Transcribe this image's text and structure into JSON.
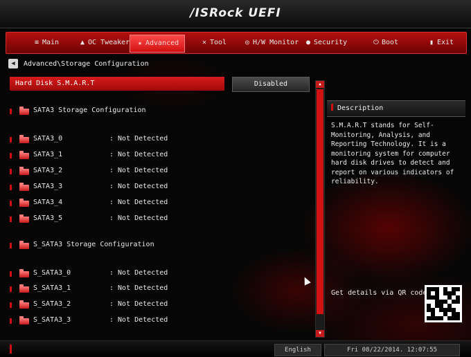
{
  "header": {
    "logo": "/ISRock UEFI"
  },
  "tabs": [
    {
      "label": "Main",
      "icon": "menu-icon",
      "glyph": "≡",
      "active": false
    },
    {
      "label": "OC Tweaker",
      "icon": "rocket-icon",
      "glyph": "▲",
      "active": false
    },
    {
      "label": "Advanced",
      "icon": "star-icon",
      "glyph": "★",
      "active": true
    },
    {
      "label": "Tool",
      "icon": "tools-icon",
      "glyph": "✕",
      "active": false
    },
    {
      "label": "H/W Monitor",
      "icon": "monitor-icon",
      "glyph": "◎",
      "active": false
    },
    {
      "label": "Security",
      "icon": "shield-icon",
      "glyph": "●",
      "active": false
    },
    {
      "label": "Boot",
      "icon": "power-icon",
      "glyph": "⏻",
      "active": false
    },
    {
      "label": "Exit",
      "icon": "exit-icon",
      "glyph": "▮",
      "active": false
    }
  ],
  "breadcrumb": "Advanced\\Storage Configuration",
  "setting": {
    "label": "Hard Disk S.M.A.R.T",
    "value": "Disabled"
  },
  "sata3": {
    "title": "SATA3 Storage Configuration",
    "ports": [
      {
        "name": "SATA3_0",
        "status": ": Not Detected"
      },
      {
        "name": "SATA3_1",
        "status": ": Not Detected"
      },
      {
        "name": "SATA3_2",
        "status": ": Not Detected"
      },
      {
        "name": "SATA3_3",
        "status": ": Not Detected"
      },
      {
        "name": "SATA3_4",
        "status": ": Not Detected"
      },
      {
        "name": "SATA3_5",
        "status": ": Not Detected"
      }
    ]
  },
  "s_sata3": {
    "title": "S_SATA3 Storage Configuration",
    "ports": [
      {
        "name": "S_SATA3_0",
        "status": ": Not Detected"
      },
      {
        "name": "S_SATA3_1",
        "status": ": Not Detected"
      },
      {
        "name": "S_SATA3_2",
        "status": ": Not Detected"
      },
      {
        "name": "S_SATA3_3",
        "status": ": Not Detected"
      }
    ]
  },
  "description": {
    "title": "Description",
    "text": "S.M.A.R.T stands for Self-Monitoring, Analysis, and Reporting Technology. It is a monitoring system for computer hard disk drives to detect and report on various indicators of reliability."
  },
  "qr": {
    "label": "Get details via QR code"
  },
  "footer": {
    "language": "English",
    "datetime": "Fri 08/22/2014. 12:07:55"
  },
  "colors": {
    "accent": "#d01010",
    "background": "#050505",
    "text": "#e6e6e6"
  }
}
